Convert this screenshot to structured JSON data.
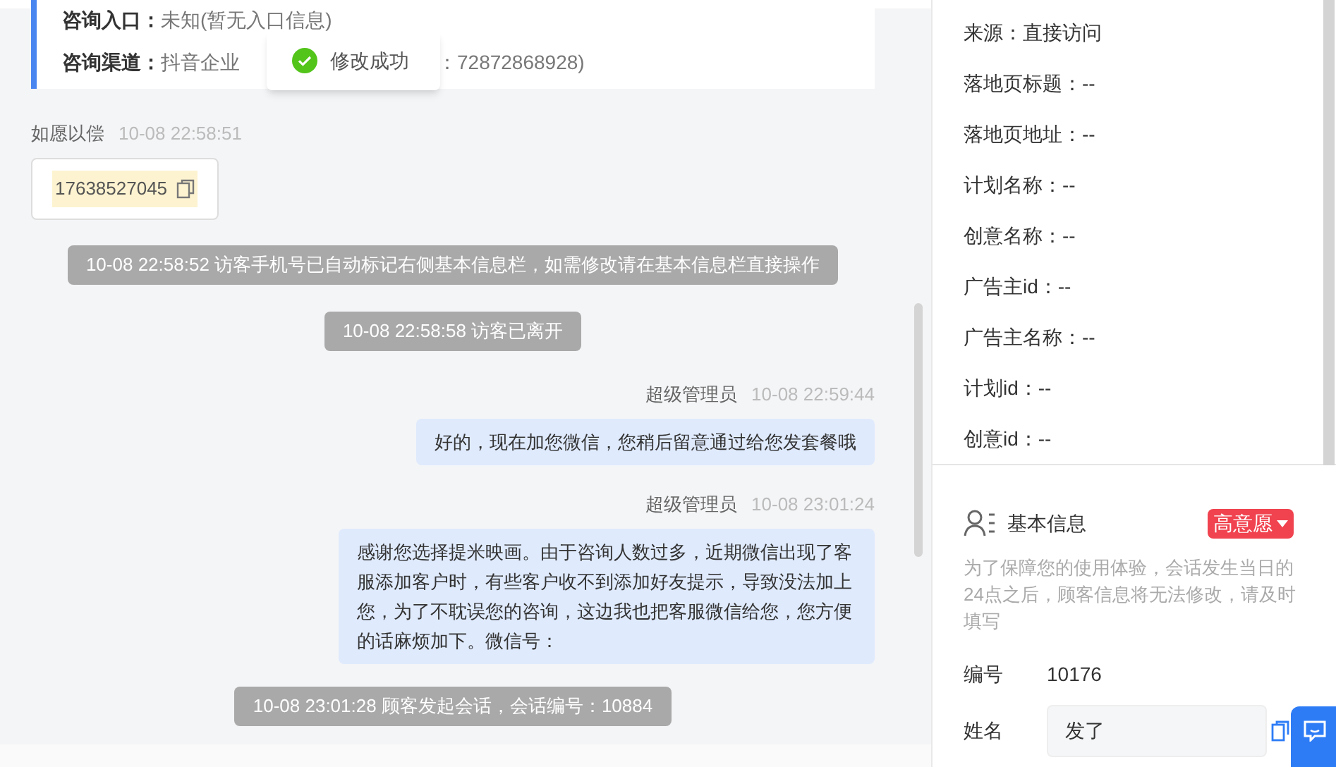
{
  "info_card": {
    "rows": [
      {
        "label": "咨询入口：",
        "value_parts": [
          "未知(暂无入口信息)"
        ]
      },
      {
        "label": "咨询渠道：",
        "value_parts": [
          "抖音企业",
          "：72872868928)"
        ]
      }
    ]
  },
  "toast": {
    "kind": "success",
    "text": "修改成功"
  },
  "messages": [
    {
      "kind": "visitor",
      "sender": "如愿以偿",
      "time": "10-08 22:58:51",
      "text": "17638527045"
    },
    {
      "kind": "system",
      "text": "10-08 22:58:52 访客手机号已自动标记右侧基本信息栏，如需修改请在基本信息栏直接操作"
    },
    {
      "kind": "system",
      "text": "10-08 22:58:58 访客已离开"
    },
    {
      "kind": "agent",
      "sender": "超级管理员",
      "time": "10-08 22:59:44",
      "text": "好的，现在加您微信，您稍后留意通过给您发套餐哦"
    },
    {
      "kind": "agent",
      "sender": "超级管理员",
      "time": "10-08 23:01:24",
      "text": "感谢您选择提米映画。由于咨询人数过多，近期微信出现了客服添加客户时，有些客户收不到添加好友提示，导致没法加上您，为了不耽误您的咨询，这边我也把客服微信给您，您方便的话麻烦加下。微信号："
    },
    {
      "kind": "system",
      "text": "10-08 23:01:28 顾客发起会话，会话编号：10884"
    }
  ],
  "source_info": [
    "来源：直接访问",
    "落地页标题：--",
    "落地页地址：--",
    "计划名称：--",
    "创意名称：--",
    "广告主id：--",
    "广告主名称：--",
    "计划id：--",
    "创意id：--"
  ],
  "basic_info": {
    "title": "基本信息",
    "intent_tag": {
      "label": "高意愿",
      "color": "#f0434f"
    },
    "notice": "为了保障您的使用体验，会话发生当日的24点之后，顾客信息将无法修改，请及时填写",
    "fields": [
      {
        "kind": "text",
        "label": "编号",
        "value": "10176"
      },
      {
        "kind": "input",
        "label": "姓名",
        "value": "发了"
      }
    ]
  }
}
